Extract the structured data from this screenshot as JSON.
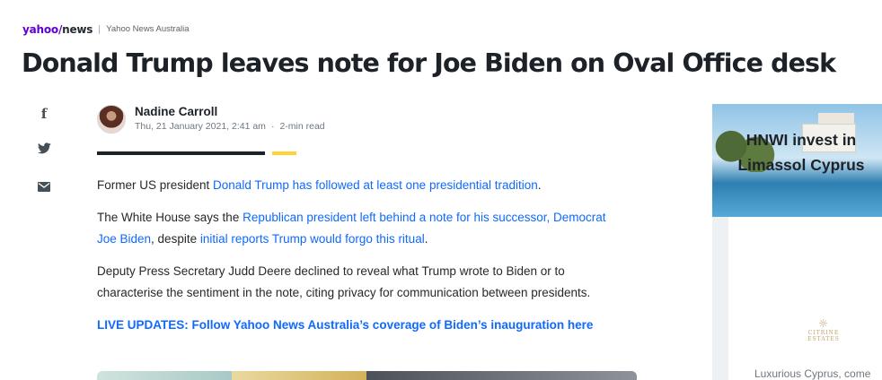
{
  "brand": {
    "logo_part1": "yahoo",
    "logo_part2": "/",
    "logo_part3": "news",
    "edition": "Yahoo News Australia"
  },
  "article": {
    "headline": "Donald Trump leaves note for Joe Biden on Oval Office desk",
    "author": "Nadine Carroll",
    "date": "Thu, 21 January 2021, 2:41 am",
    "meta_separator": "·",
    "read_time": "2-min read",
    "p1_before": "Former US president ",
    "p1_link": "Donald Trump has followed at least one presidential tradition",
    "p1_after": ".",
    "p2_before": "The White House says the ",
    "p2_link1": "Republican president left behind a note for his successor, Democrat Joe Biden",
    "p2_mid": ", despite ",
    "p2_link2": "initial reports Trump would forgo this ritual",
    "p2_after": ".",
    "p3": "Deputy Press Secretary Judd Deere declined to reveal what Trump wrote to Biden or to characterise the sentiment in the note, citing privacy for communication between presidents.",
    "live_updates": "LIVE UPDATES: Follow Yahoo News Australia’s coverage of Biden’s inauguration here"
  },
  "share": {
    "icons": [
      "facebook-icon",
      "twitter-icon",
      "mail-icon"
    ]
  },
  "ad": {
    "title_line1": "HNWI invest in",
    "title_line2": "Limassol Cyprus",
    "logo_line1": "CITRINE",
    "logo_line2": "ESTATES",
    "description": "Luxurious Cyprus, come"
  },
  "colors": {
    "accent_link": "#0f69ff",
    "brand_purple": "#6001d2",
    "divider_yellow": "#ffd333",
    "text_dark": "#1d2228"
  }
}
